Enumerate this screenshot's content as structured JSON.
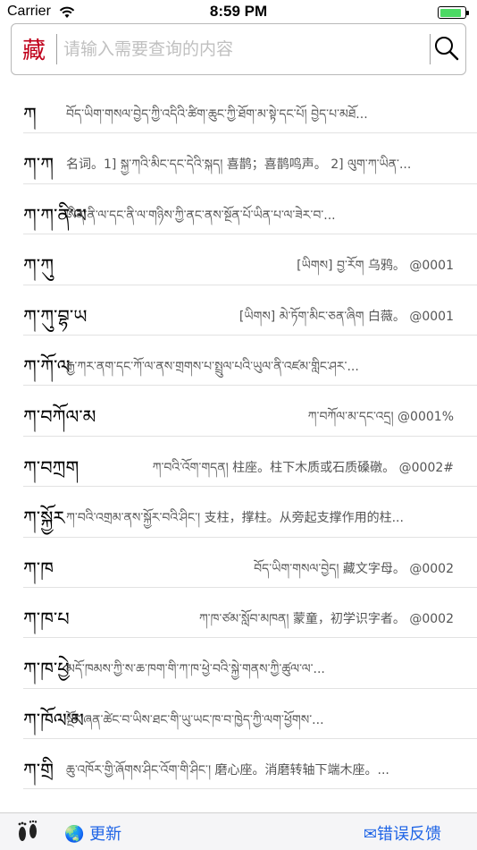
{
  "status_bar": {
    "carrier": "Carrier",
    "time": "8:59 PM",
    "battery_level": 0.9,
    "battery_color": "#4cd964"
  },
  "search": {
    "logo": "藏",
    "logo_color": "#c0001a",
    "placeholder": "请输入需要查询的内容",
    "button_icon": "magnifier-icon"
  },
  "entries": [
    {
      "word": "ཀ",
      "definition": "བོད་ཡིག་གསལ་བྱེད་ཀྱི་འདིའི་ཚིག་ཆུང་ཀྱི་ཐོག་མ་སྟེ་དང་པོ། བྱེད་པ་མཐོ...",
      "align": "left"
    },
    {
      "word": "ཀ་ཀ",
      "definition": "名词。1] སྐྱ་ཀའི་མིང་དང་དེའི་སྐད། 喜鹊；喜鹊鸣声。 2] ལུག་ཀ་ཡིན་...",
      "align": "left"
    },
    {
      "word": "ཀ་ཀ་ནི་ལ",
      "definition": "ཨིན་ནི་ལ་དང་ནི་ལ་གཉིས་ཀྱི་ནང་ནས་སྔོན་པོ་ཡིན་པ་ལ་ཟེར་བ་...",
      "align": "left"
    },
    {
      "word": "ཀ་ཀུ",
      "definition": "[ཡིགས] བྱ་རོག 乌鸦。 @0001",
      "align": "right"
    },
    {
      "word": "ཀ་ཀུ་བྷ་ཡ",
      "definition": "[ཡིགས] མེ་ཏོག་མིང་ཅན་ཞིག 白薇。 @0001",
      "align": "right"
    },
    {
      "word": "ཀ་ཀོ་ལ",
      "definition": "རྒྱ་ཀར་ནག་དང་ཀོ་ལ་ནས་གྲགས་པ་སྤྲུལ་པའི་ཡུལ་ནི་འཛམ་གླིང་ཤར་...",
      "align": "left"
    },
    {
      "word": "ཀ་བཀོལ་མ",
      "definition": "ཀ་བཀོལ་མ་དང་འདྲ། @0001%",
      "align": "right"
    },
    {
      "word": "ཀ་བཀྲག",
      "definition": "ཀ་བའི་འོག་གདན། 柱座。柱下木质或石质磉礅。 @0002#",
      "align": "right"
    },
    {
      "word": "ཀ་སྐྱོར",
      "definition": "ཀ་བའི་འགྲམ་ནས་སྐྱོར་བའི་ཤིང་། 支柱，撑柱。从旁起支撑作用的柱...",
      "align": "left"
    },
    {
      "word": "ཀ་ཁ",
      "definition": "བོད་ཡིག་གསལ་བྱེད། 藏文字母。 @0002",
      "align": "right"
    },
    {
      "word": "ཀ་ཁ་པ",
      "definition": "ཀ་ཁ་ཙམ་སློབ་མཁན། 蒙童，初学识字者。 @0002",
      "align": "right"
    },
    {
      "word": "ཀ་ཁ་ཕྱེ",
      "definition": "མདོ་ཁམས་ཀྱི་ས་ཆ་ཁག་གི་ཀ་ཁ་ཕྱེ་བའི་སྐྱེ་གནས་ཀྱི་ཚུལ་ལ་...",
      "align": "left"
    },
    {
      "word": "ཀ་ཁོལ་མ",
      "definition": "སྔོང་ཞན་ཚེང་བ་ཡིས་ཐང་གི་ཡུ་ཡང་ཁ་བ་ཁྱེད་ཀྱི་ལག་ཕྱོགས་...",
      "align": "left"
    },
    {
      "word": "ཀ་གྲི",
      "definition": "ཆུ་འཁོར་གྱི་ཞོགས་ཤིང་འོག་གི་ཤིང་། 磨心座。消磨转轴下端木座。...",
      "align": "left"
    }
  ],
  "bottom_bar": {
    "feet_icon": "footprints-icon",
    "update_label": "更新",
    "update_icon": "globe-icon",
    "feedback_label": "错误反馈",
    "feedback_icon": "envelope-icon",
    "link_color": "#1e64e6"
  }
}
